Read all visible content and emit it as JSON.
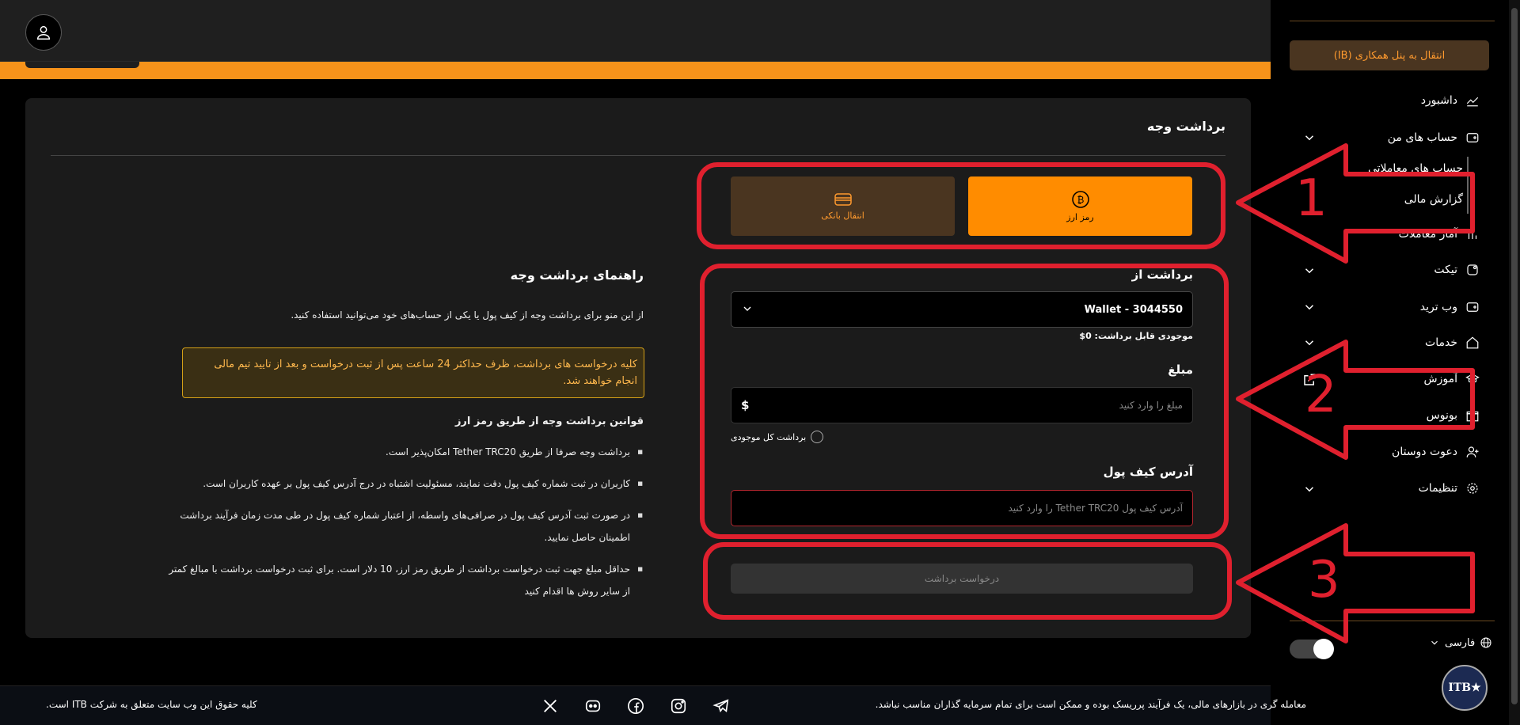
{
  "header": {
    "avatar_icon": "user-icon"
  },
  "panel": {
    "title": "برداشت وجه",
    "methods": [
      {
        "label": "رمز ارز",
        "icon": "bitcoin-icon",
        "active": true
      },
      {
        "label": "انتقال بانکی",
        "icon": "card-icon",
        "active": false
      }
    ],
    "from_label": "برداشت از",
    "wallet_value": "Wallet - 3044550",
    "available_balance": "موجودی قابل برداشت: 0$",
    "amount_label": "مبلغ",
    "amount_placeholder": "مبلغ را وارد کنید",
    "currency_symbol": "$",
    "withdraw_all_label": "برداشت کل موجودی",
    "wallet_address_label": "آدرس کیف پول",
    "wallet_address_placeholder": "آدرس کیف پول Tether TRC20 را وارد کنید",
    "submit_label": "درخواست برداشت"
  },
  "guide": {
    "title": "راهنمای برداشت وجه",
    "intro": "از این منو برای برداشت وجه از کیف پول یا یکی از حساب‌های خود می‌توانید استفاده کنید.",
    "warning": "کلیه درخواست های برداشت، ظرف حداکثر 24 ساعت پس از ثبت درخواست و بعد از تایید تیم مالی انجام خواهند شد.",
    "rules_title": "قوانین برداشت وجه از طریق رمز ارز",
    "rules": [
      "برداشت وجه صرفا از طریق Tether TRC20 امکان‌پذیر است.",
      "کاربران در ثبت شماره کیف پول دقت نمایند، مسئولیت اشتباه در درج آدرس کیف پول بر عهده کاربران است.",
      "در صورت ثبت آدرس کیف پول در صرافی‌های واسطه، از اعتبار شماره کیف پول در طی مدت زمان فرآیند برداشت اطمینان حاصل نمایید.",
      "حداقل مبلغ جهت ثبت درخواست برداشت از طریق رمز ارز، 10 دلار است. برای ثبت درخواست برداشت با مبالغ کمتر از سایر روش ها اقدام کنید"
    ]
  },
  "sidebar": {
    "ib_button": "انتقال به پنل همکاری (IB)",
    "items": [
      {
        "label": "داشبورد",
        "icon": "chart-icon",
        "chevron": false
      },
      {
        "label": "حساب های من",
        "icon": "wallet-icon",
        "chevron": true
      },
      {
        "label": "آمار معاملات",
        "icon": "bar-chart-icon",
        "chevron": true
      },
      {
        "label": "تیکت",
        "icon": "ticket-icon",
        "chevron": true
      },
      {
        "label": "وب ترید",
        "icon": "webtrade-icon",
        "chevron": true
      },
      {
        "label": "خدمات",
        "icon": "home-icon",
        "chevron": true
      },
      {
        "label": "آموزش",
        "icon": "education-icon",
        "chevron": false
      },
      {
        "label": "بونوس",
        "icon": "gift-icon",
        "chevron": false
      },
      {
        "label": "دعوت دوستان",
        "icon": "invite-icon",
        "chevron": false
      },
      {
        "label": "تنظیمات",
        "icon": "gear-icon",
        "chevron": true
      }
    ],
    "subitems": [
      "حساب های معاملاتی",
      "گزارش مالی"
    ],
    "language": "فارسی",
    "logo_text": "ITB★"
  },
  "footer": {
    "copyright": "کلیه حقوق این وب سایت متعلق به شرکت ITB است.",
    "risk": "معامله گری در بازارهای مالی، یک فرآیند پرریسک بوده و ممکن است برای تمام سرمایه گذاران مناسب نباشد.",
    "social": [
      "x-icon",
      "discord-icon",
      "facebook-icon",
      "instagram-icon",
      "telegram-icon"
    ]
  },
  "annotations": [
    "1",
    "2",
    "3"
  ],
  "colors": {
    "accent": "#f7931a",
    "annotation": "#e0202e",
    "warning_border": "#d4a017"
  }
}
